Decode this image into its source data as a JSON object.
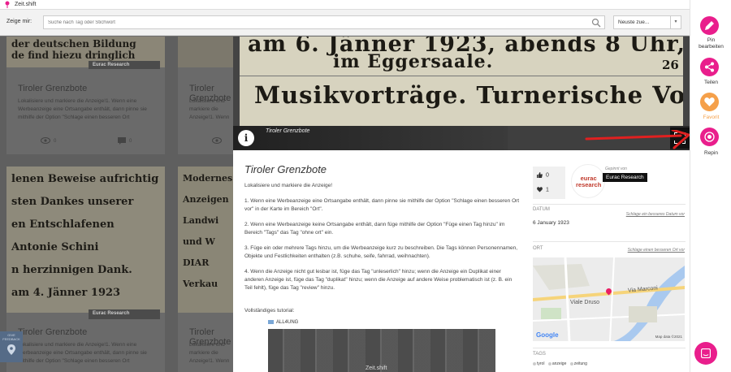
{
  "app": {
    "title": "Zeit.shift"
  },
  "filter": {
    "label": "Zeige mir:",
    "search_placeholder": "Suche nach Tag oder Stichwort",
    "sort_value": "Neuste zue..."
  },
  "grid": {
    "cards": [
      {
        "img_text": "der deutschen Bildung\nde find hiezu dringlich",
        "title": "Tiroler Grenzbote",
        "desc": "Lokalisiere und markiere die Anzeige!1. Wenn eine Werbeanzeige eine Ortsangabe enthält, dann pinne sie mithilfe der Option \"Schlage einen besseren Ort",
        "votes": "0",
        "comments": "0",
        "eurac": "Eurac Research"
      },
      {
        "img_text": "",
        "title": "Tiroler Grenzbote",
        "desc": "Lokalisiere und markiere die Anzeige!1. Wenn eine Werbeanzeige eine Ortsangabe enthält, dann pinne sie mithilfe der Option \"Schlage einen besseren Ort",
        "votes": "",
        "comments": "",
        "eurac": ""
      },
      {
        "img_text": "lenen Beweise aufrichtig\nsten Dankes unserer\nen Entschlafenen\nAntonie Schini\nn herzinnigen Dank.\nam 4. Jänner 1923",
        "title": "Tiroler Grenzbote",
        "desc": "Lokalisiere und markiere die Anzeige!1. Wenn eine Werbeanzeige eine Ortsangabe enthält, dann pinne sie mithilfe der Option \"Schlage einen besseren Ort",
        "votes": "",
        "comments": "",
        "eurac": "Eurac Research"
      },
      {
        "img_text": "Modernes\nAnzeigen\nLandwi\nund W\nDIAR\nVerkau",
        "title": "Tiroler Grenzbote",
        "desc": "Lokalisiere und markiere die Anzeige!1. Wenn eine Werbeanzeige eine Ortsangabe enthält, dann pinne sie mithilfe der Option \"Schlage einen besseren Ort",
        "votes": "",
        "comments": "",
        "eurac": ""
      }
    ]
  },
  "modal": {
    "photo_lines": [
      "am 6. Jänner 1923, abends 8 Uhr,",
      "im Eggersaale.",
      "Musikvorträge. Turnerische Vorführungen."
    ],
    "photo_num": "26",
    "caption": "Tiroler Grenzbote",
    "title": "Tiroler Grenzbote",
    "intro": "Lokalisiere und markiere die Anzeige!",
    "paragraphs": [
      "1. Wenn eine Werbeanzeige eine Ortsangabe enthält, dann pinne sie mithilfe der Option \"Schlage einen besseren Ort vor\" in der Karte im Bereich \"Ort\".",
      "2. Wenn eine Werbeanzeige keine Ortsangabe enthält, dann füge mithilfe der Option \"Füge einen Tag hinzu\" im Bereich \"Tags\" das Tag \"ohne ort\" ein.",
      "3. Füge ein oder mehrere Tags hinzu, um die Werbeanzeige kurz zu beschreiben. Die Tags können Personennamen, Objekte und Festlichkeiten enthalten (z.B. schuhe, seife, fahrrad, weihnachten).",
      "4. Wenn die Anzeige nicht gut lesbar ist, füge das Tag \"unleserlich\" hinzu; wenn die Anzeige ein Duplikat einer anderen Anzeige ist, füge das Tag \"duplikat\" hinzu; wenn die Anzeige auf andere Weise problematisch ist (z. B. ein Teil fehlt), füge das Tag \"review\" hinzu."
    ],
    "tutorial_label": "Vollständiges tutorial:",
    "doc_label": "ALL4UNG",
    "video_text": "Zeit.shift",
    "votes_up": "0",
    "votes_heart": "1",
    "sponsor_small": "Gepinnt von",
    "sponsor_name": "Eurac Research",
    "sponsor_logo": "eurac\nresearch",
    "date_label": "DATUM",
    "date_link": "Schlage ein besseres Datum vor",
    "date_value": "6 January 1923",
    "place_label": "ORT",
    "place_link": "Schlage einen besseren Ort vor",
    "map": {
      "street1": "Viale Druso",
      "street2": "Via Marconi",
      "google": "Google",
      "copyright": "Map data ©2021"
    },
    "tags_label": "TAGS",
    "tags": [
      "tyrol",
      "anzeige",
      "zeitung"
    ]
  },
  "rail": {
    "pin_label": "Pin bearbeiten",
    "share_label": "Teilen",
    "fav_label": "Favorit",
    "repin_label": "Repin",
    "colors": {
      "pink": "#e91e8c",
      "orange": "#f5a04a"
    }
  },
  "feedback": {
    "text": "GIVE\nFEEDBACK"
  }
}
